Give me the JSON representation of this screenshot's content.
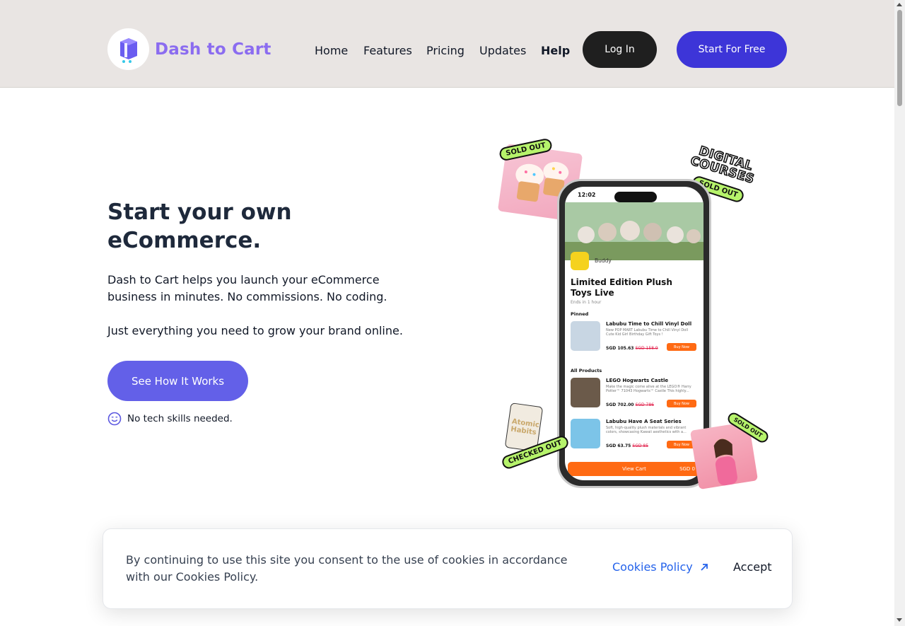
{
  "header": {
    "brand": "Dash to Cart",
    "nav": [
      {
        "label": "Home"
      },
      {
        "label": "Features"
      },
      {
        "label": "Pricing"
      },
      {
        "label": "Updates"
      },
      {
        "label": "Help"
      }
    ],
    "login_label": "Log In",
    "start_label": "Start For Free"
  },
  "hero": {
    "title": "Start your own eCommerce.",
    "description": "Dash to Cart helps you launch your eCommerce business in minutes. No commissions. No coding.",
    "description2": "Just everything you need to grow your brand online.",
    "cta_label": "See How It Works",
    "note": "No tech skills needed."
  },
  "illustration": {
    "sticker_top_left": "SOLD OUT",
    "digital_courses": "DIGITAL COURSES",
    "sticker_top_right": "SOLD OUT",
    "sticker_bottom_left": "CHECKED OUT",
    "sticker_bottom_right": "SOLD OUT",
    "book_title": "Atomic Habits",
    "phone": {
      "time": "12:02",
      "brand_name": "Buddy",
      "live_title": "Limited Edition Plush Toys Live",
      "ends": "Ends in 1 hour",
      "pinned_label": "Pinned",
      "all_products_label": "All Products",
      "products": [
        {
          "name": "Labubu Time to Chill Vinyl Doll",
          "desc": "New POP MART Labubu Time to Chill Vinyl Doll Cute Kid Girl Birthday Gift Toys !",
          "price": "SGD 105.63",
          "old_price": "SGD 158.9",
          "buy": "Buy Now"
        },
        {
          "name": "LEGO Hogwarts Castle",
          "desc": "Make the magic come alive at the LEGO® Harry Potter™ 71043 Hogwarts™ Castle This highly...",
          "price": "SGD 702.00",
          "old_price": "SGD 786",
          "buy": "Buy Now"
        },
        {
          "name": "Labubu Have A Seat Series",
          "desc": "Soft, high-quality plush materials and vibrant colors, showcasing Kawaii aesthetics with a...",
          "price": "SGD 63.75",
          "old_price": "SGD 85",
          "buy": "Buy Now"
        }
      ],
      "cart_label": "View Cart",
      "cart_total": "SGD 0"
    }
  },
  "cookie": {
    "text": "By continuing to use this site you consent to the use of cookies in accordance with our Cookies Policy.",
    "policy_label": "Cookies Policy",
    "accept_label": "Accept"
  },
  "colors": {
    "header_bg": "#e9e5e3",
    "brand": "#8b6cf0",
    "start_button": "#3d35d8",
    "cta_button": "#6360e8",
    "login_button": "#1f1f1f",
    "link": "#2563eb",
    "sticker": "#b6f36b",
    "phone_accent": "#ff6a13"
  }
}
